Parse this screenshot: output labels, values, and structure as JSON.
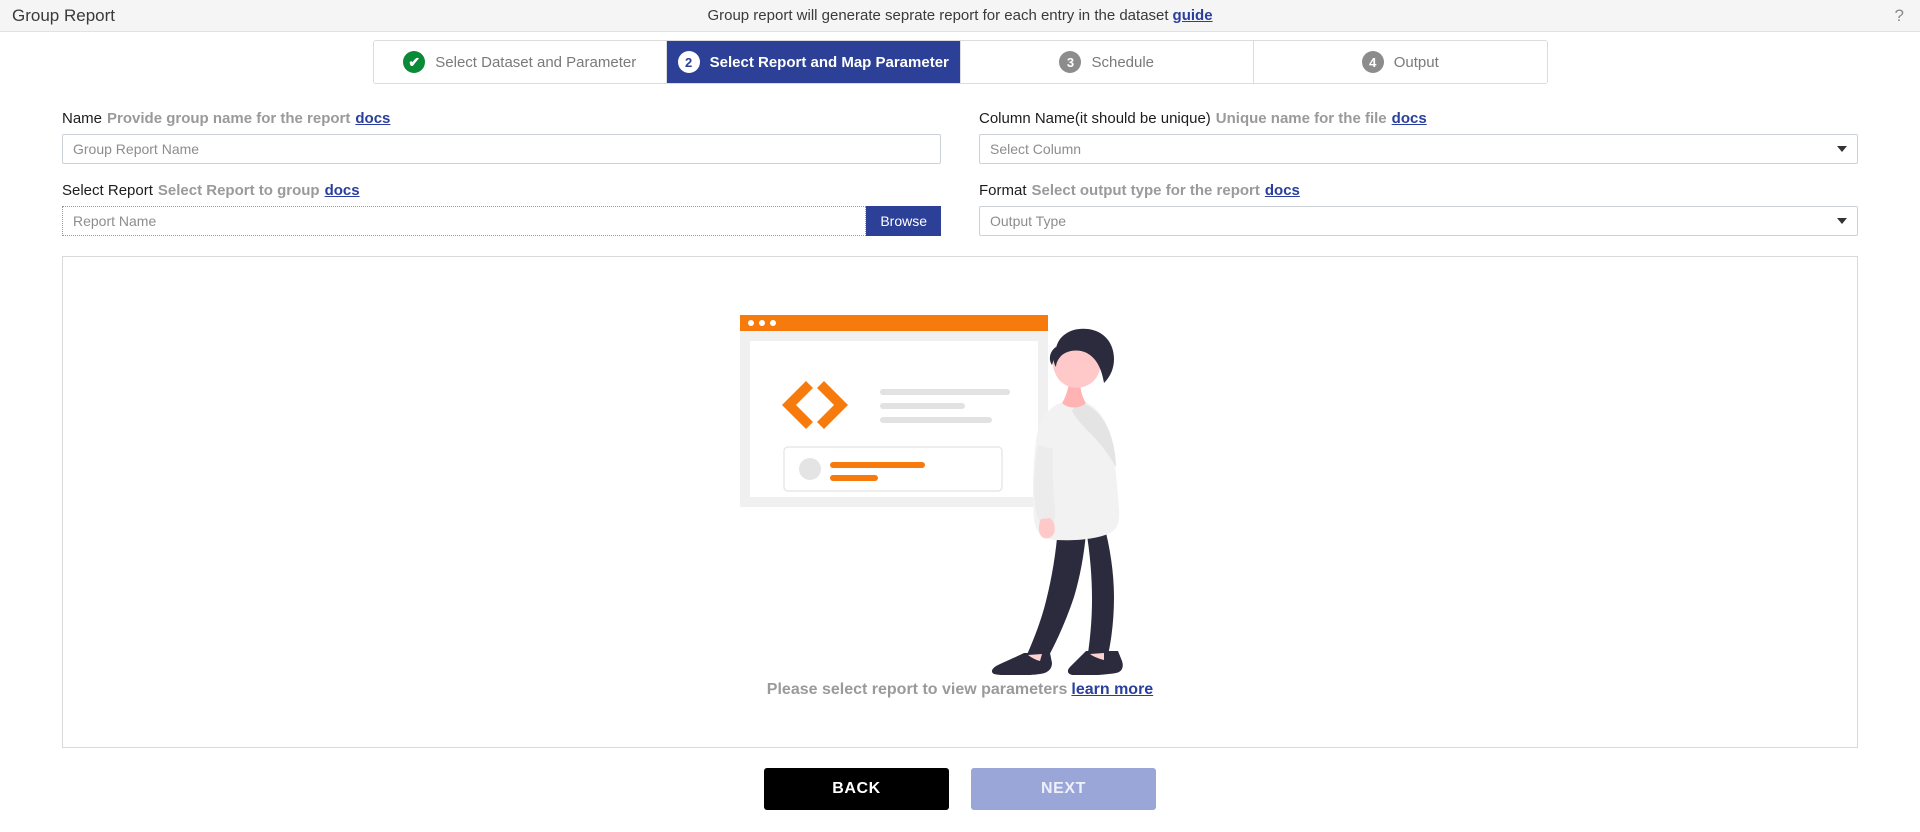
{
  "topbar": {
    "title": "Group Report",
    "description": "Group report will generate seprate report for each entry in the dataset",
    "guide_link": "guide",
    "help_icon": "question-mark-icon"
  },
  "stepper": {
    "steps": [
      {
        "badge": "✔",
        "label": "Select Dataset and Parameter",
        "state": "completed"
      },
      {
        "badge": "2",
        "label": "Select Report and Map Parameter",
        "state": "active"
      },
      {
        "badge": "3",
        "label": "Schedule",
        "state": "pending"
      },
      {
        "badge": "4",
        "label": "Output",
        "state": "pending"
      }
    ]
  },
  "form": {
    "name": {
      "label": "Name",
      "hint": "Provide group name for the report",
      "docs": "docs",
      "placeholder": "Group Report Name",
      "value": ""
    },
    "column_name": {
      "label": "Column Name(it should be unique)",
      "hint": "Unique name for the file",
      "docs": "docs",
      "placeholder": "Select Column",
      "value": ""
    },
    "select_report": {
      "label": "Select Report",
      "hint": "Select Report to group",
      "docs": "docs",
      "placeholder": "Report Name",
      "value": "",
      "browse_label": "Browse"
    },
    "format": {
      "label": "Format",
      "hint": "Select output type for the report",
      "docs": "docs",
      "placeholder": "Output Type",
      "value": ""
    }
  },
  "panel": {
    "illustration": "empty-state-browser-window-with-person-illustration",
    "message": "Please select report to view parameters",
    "learn_more": "learn more"
  },
  "footer": {
    "back_label": "BACK",
    "next_label": "NEXT"
  },
  "colors": {
    "accent_blue": "#2b4096",
    "link_blue": "#2a3f9d",
    "check_green": "#0a8a36",
    "orange": "#f77a0c",
    "next_disabled": "#9aa6d8",
    "back_black": "#000000"
  }
}
